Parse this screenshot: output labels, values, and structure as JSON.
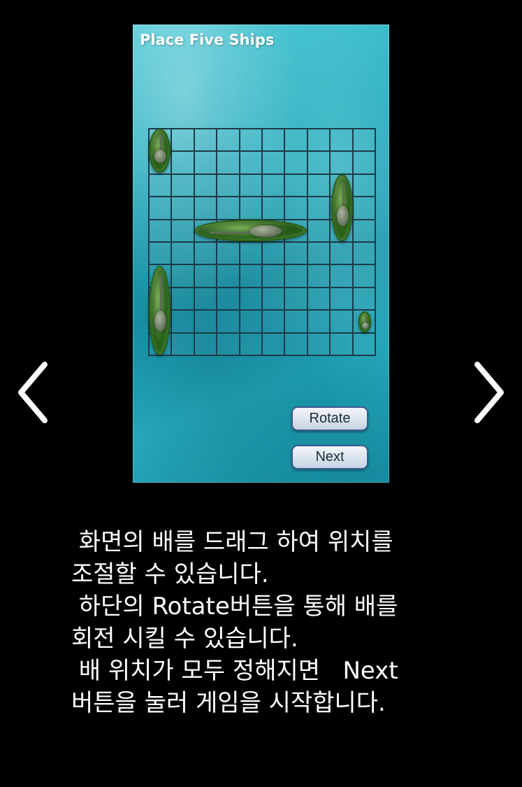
{
  "screen": {
    "title": "Place Five Ships",
    "rotate_label": "Rotate",
    "next_label": "Next"
  },
  "grid": {
    "rows": 10,
    "cols": 10
  },
  "ships": [
    {
      "row": 0,
      "col": 0,
      "length": 2,
      "orientation": "vertical"
    },
    {
      "row": 2,
      "col": 8,
      "length": 3,
      "orientation": "vertical"
    },
    {
      "row": 4,
      "col": 2,
      "length": 5,
      "orientation": "horizontal"
    },
    {
      "row": 6,
      "col": 0,
      "length": 4,
      "orientation": "vertical"
    },
    {
      "row": 8,
      "col": 9,
      "length": 1,
      "orientation": "vertical"
    }
  ],
  "navigation": {
    "prev_icon": "chevron-left-icon",
    "next_icon": "chevron-right-icon"
  },
  "caption": {
    "line1": " 화면의 배를 드래그 하여 위치를",
    "line2": "조절할 수 있습니다.",
    "line3": " 하단의 Rotate버튼을 통해 배를",
    "line4": "회전 시킬 수 있습니다.",
    "line5": " 배 위치가 모두 정해지면   Next",
    "line6": "버튼을 눌러 게임을 시작합니다."
  },
  "colors": {
    "background": "#000000",
    "sea": "#22a9bb",
    "grid_line": "#1b3b47",
    "ship": "#3c8a26",
    "button_border": "#3d5a8f"
  }
}
